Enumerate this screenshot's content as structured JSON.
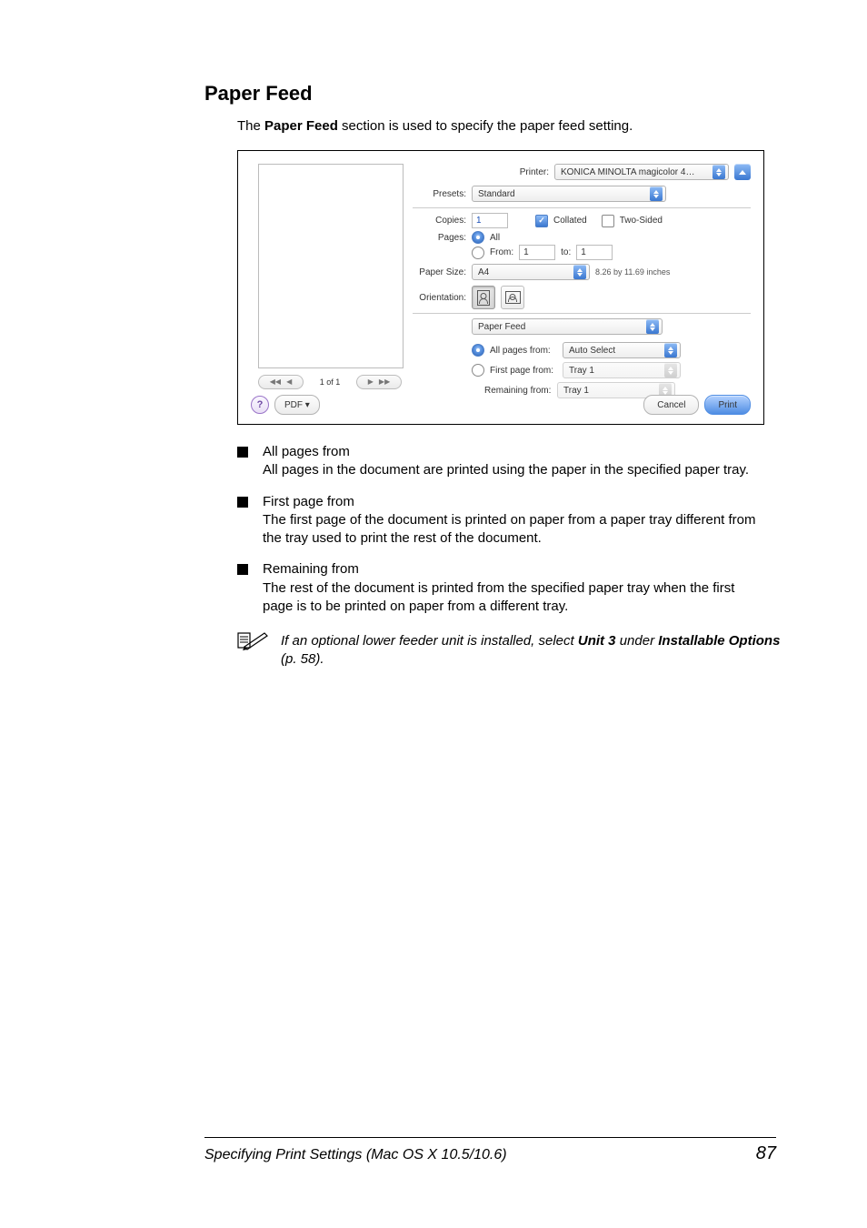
{
  "heading": "Paper Feed",
  "intro_pre": "The ",
  "intro_bold": "Paper Feed",
  "intro_post": " section is used to specify the paper feed setting.",
  "dialog": {
    "labels": {
      "printer": "Printer:",
      "presets": "Presets:",
      "copies": "Copies:",
      "collated": "Collated",
      "twosided": "Two-Sided",
      "pages": "Pages:",
      "all": "All",
      "from": "From:",
      "to": "to:",
      "paper_size": "Paper Size:",
      "paper_size_note": "8.26 by 11.69 inches",
      "orientation": "Orientation:",
      "all_pages_from": "All pages from:",
      "first_page_from": "First page from:",
      "remaining_from": "Remaining from:"
    },
    "values": {
      "printer": "KONICA MINOLTA magicolor 4…",
      "presets": "Standard",
      "copies": "1",
      "from": "1",
      "to": "1",
      "paper_size": "A4",
      "pane": "Paper Feed",
      "all_pages_src": "Auto Select",
      "first_page_src": "Tray 1",
      "remaining_src": "Tray 1"
    },
    "nav_count": "1 of 1",
    "buttons": {
      "pdf": "PDF ▾",
      "cancel": "Cancel",
      "print": "Print"
    }
  },
  "bullets": [
    {
      "title": "All pages from",
      "body": "All pages in the document are printed using the paper in the specified paper tray."
    },
    {
      "title": "First page from",
      "body": "The first page of the document is printed on paper from a paper tray different from the tray used to print the rest of the document."
    },
    {
      "title": "Remaining from",
      "body": "The rest of the document is printed from the specified paper tray when the first page is to be printed on paper from a different tray."
    }
  ],
  "note": {
    "pre": "If an optional lower feeder unit is installed, select ",
    "bold1": "Unit 3",
    "mid": " under ",
    "bold2": "Installable Options",
    "post": " (p. 58)."
  },
  "footer": {
    "left": "Specifying Print Settings (Mac OS X 10.5/10.6)",
    "right": "87"
  }
}
